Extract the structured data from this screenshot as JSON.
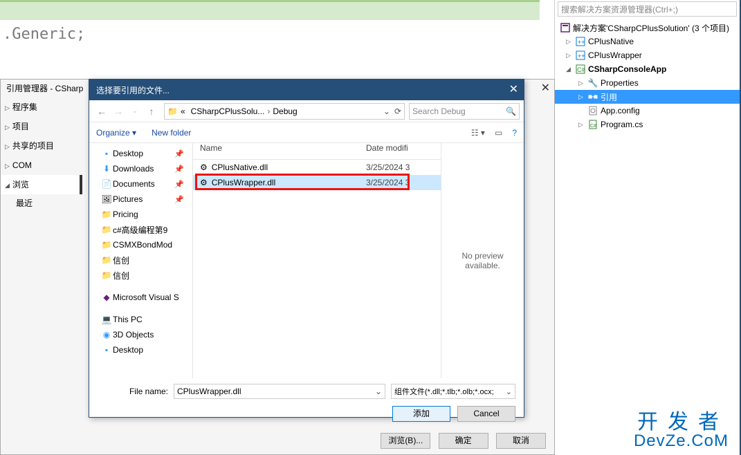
{
  "code": {
    "line": ".Generic;"
  },
  "solution_explorer": {
    "search_placeholder": "搜索解决方案资源管理器(Ctrl+;)",
    "root": "解决方案'CSharpCPlusSolution' (3 个项目)",
    "projects": {
      "p1": "CPlusNative",
      "p2": "CPlusWrapper",
      "p3": "CSharpConsoleApp",
      "p3_properties": "Properties",
      "p3_refs": "引用",
      "p3_appconfig": "App.config",
      "p3_program": "Program.cs"
    }
  },
  "ref_mgr": {
    "title": "引用管理器 - CSharp",
    "nav": {
      "assemblies": "程序集",
      "projects": "项目",
      "shared": "共享的项目",
      "com": "COM",
      "browse": "浏览",
      "recent": "最近"
    },
    "buttons": {
      "browse": "浏览(B)...",
      "ok": "确定",
      "cancel": "取消"
    }
  },
  "file_dlg": {
    "title": "选择要引用的文件...",
    "path": {
      "folder_icon": "📁",
      "crumb1": "CSharpCPlusSolu...",
      "crumb2": "Debug"
    },
    "search_placeholder": "Search Debug",
    "toolbar": {
      "organize": "Organize",
      "new_folder": "New folder"
    },
    "columns": {
      "name": "Name",
      "date": "Date modifi"
    },
    "places": {
      "desktop": "Desktop",
      "downloads": "Downloads",
      "documents": "Documents",
      "pictures": "Pictures",
      "pricing": "Pricing",
      "book": "c#高级编程第9",
      "csmx": "CSMXBondMod",
      "xc1": "信创",
      "xc2": "信创",
      "vs": "Microsoft Visual S",
      "thispc": "This PC",
      "3d": "3D Objects",
      "desktop2": "Desktop"
    },
    "files": [
      {
        "name": "CPlusNative.dll",
        "date": "3/25/2024 3"
      },
      {
        "name": "CPlusWrapper.dll",
        "date": "3/25/2024 3"
      }
    ],
    "preview": {
      "l1": "No preview",
      "l2": "available."
    },
    "filename_label": "File name:",
    "filename_value": "CPlusWrapper.dll",
    "filter": "组件文件(*.dll;*.tlb;*.olb;*.ocx;",
    "buttons": {
      "add": "添加",
      "cancel": "Cancel"
    }
  },
  "watermark": {
    "l1": "开发者",
    "l2": "DevZe.CoM"
  }
}
